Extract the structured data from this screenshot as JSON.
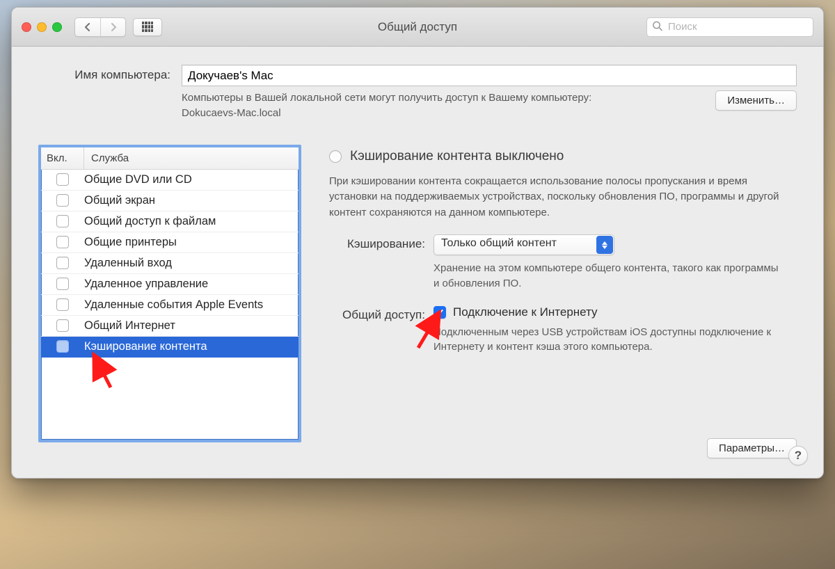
{
  "window_title": "Общий доступ",
  "search_placeholder": "Поиск",
  "name_label": "Имя компьютера:",
  "computer_name": "Докучаев's Mac",
  "name_desc": "Компьютеры в Вашей локальной сети могут получить доступ к Вашему компьютеру: Dokucaevs-Mac.local",
  "edit_button": "Изменить…",
  "list": {
    "head_on": "Вкл.",
    "head_svc": "Служба",
    "items": [
      {
        "label": "Общие DVD или CD",
        "selected": false
      },
      {
        "label": "Общий экран",
        "selected": false
      },
      {
        "label": "Общий доступ к файлам",
        "selected": false
      },
      {
        "label": "Общие принтеры",
        "selected": false
      },
      {
        "label": "Удаленный вход",
        "selected": false
      },
      {
        "label": "Удаленное управление",
        "selected": false
      },
      {
        "label": "Удаленные события Apple Events",
        "selected": false
      },
      {
        "label": "Общий Интернет",
        "selected": false
      },
      {
        "label": "Кэширование контента",
        "selected": true
      }
    ]
  },
  "right": {
    "status": "Кэширование контента выключено",
    "status_desc": "При кэшировании контента сокращается использование полосы пропускания и время установки на поддерживаемых устройствах, поскольку обновления ПО, программы и другой контент сохраняются на данном компьютере.",
    "caching_label": "Кэширование:",
    "caching_select": "Только общий контент",
    "caching_desc": "Хранение на этом компьютере общего контента, такого как программы и обновления ПО.",
    "sharing_label": "Общий доступ:",
    "sharing_checkbox_label": "Подключение к Интернету",
    "sharing_desc": "Подключенным через USB устройствам iOS доступны подключение к Интернету и контент кэша этого компьютера.",
    "options_button": "Параметры…"
  }
}
